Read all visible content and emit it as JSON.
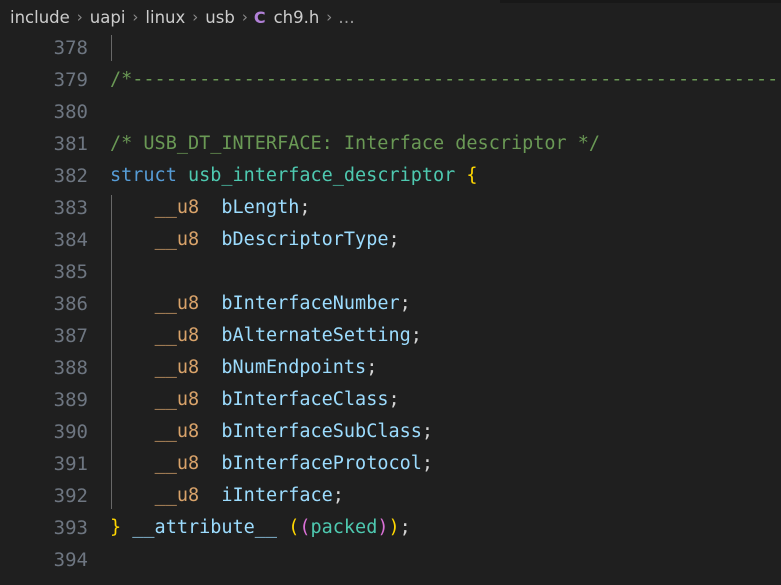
{
  "breadcrumb": {
    "separator": "›",
    "file_icon": "C",
    "items": [
      {
        "label": "include"
      },
      {
        "label": "uapi"
      },
      {
        "label": "linux"
      },
      {
        "label": "usb"
      },
      {
        "label": "ch9.h"
      }
    ],
    "overflow": "…"
  },
  "editor": {
    "language": "c",
    "theme": "dark-modern",
    "colors": {
      "background": "#1f1f1f",
      "line_number": "#6e7681",
      "comment": "#6a9955",
      "keyword": "#569cd6",
      "type": "#4ec9b0",
      "macro_type": "#d9a36a",
      "identifier": "#9cdcfe",
      "punctuation": "#d4d4d4",
      "bracket_level_1": "#ffd700",
      "bracket_level_2": "#da70d6",
      "indent_guide": "#686868"
    },
    "lines": [
      {
        "number": "378",
        "tokens": []
      },
      {
        "number": "379",
        "tokens": [
          {
            "t": "/*-------------------------------------------------------------------------",
            "c": "tok-comment"
          }
        ]
      },
      {
        "number": "380",
        "tokens": []
      },
      {
        "number": "381",
        "tokens": [
          {
            "t": "/* USB_DT_INTERFACE: Interface descriptor */",
            "c": "tok-comment"
          }
        ]
      },
      {
        "number": "382",
        "tokens": [
          {
            "t": "struct",
            "c": "tok-keyword"
          },
          {
            "t": " ",
            "c": "tok-punct"
          },
          {
            "t": "usb_interface_descriptor",
            "c": "tok-type"
          },
          {
            "t": " ",
            "c": "tok-punct"
          },
          {
            "t": "{",
            "c": "tok-br1"
          }
        ]
      },
      {
        "number": "383",
        "tokens": [
          {
            "t": "    ",
            "c": "tok-punct"
          },
          {
            "t": "__u8",
            "c": "tok-u8"
          },
          {
            "t": "  ",
            "c": "tok-punct"
          },
          {
            "t": "bLength",
            "c": "tok-ident"
          },
          {
            "t": ";",
            "c": "tok-punct"
          }
        ]
      },
      {
        "number": "384",
        "tokens": [
          {
            "t": "    ",
            "c": "tok-punct"
          },
          {
            "t": "__u8",
            "c": "tok-u8"
          },
          {
            "t": "  ",
            "c": "tok-punct"
          },
          {
            "t": "bDescriptorType",
            "c": "tok-ident"
          },
          {
            "t": ";",
            "c": "tok-punct"
          }
        ]
      },
      {
        "number": "385",
        "tokens": []
      },
      {
        "number": "386",
        "tokens": [
          {
            "t": "    ",
            "c": "tok-punct"
          },
          {
            "t": "__u8",
            "c": "tok-u8"
          },
          {
            "t": "  ",
            "c": "tok-punct"
          },
          {
            "t": "bInterfaceNumber",
            "c": "tok-ident"
          },
          {
            "t": ";",
            "c": "tok-punct"
          }
        ]
      },
      {
        "number": "387",
        "tokens": [
          {
            "t": "    ",
            "c": "tok-punct"
          },
          {
            "t": "__u8",
            "c": "tok-u8"
          },
          {
            "t": "  ",
            "c": "tok-punct"
          },
          {
            "t": "bAlternateSetting",
            "c": "tok-ident"
          },
          {
            "t": ";",
            "c": "tok-punct"
          }
        ]
      },
      {
        "number": "388",
        "tokens": [
          {
            "t": "    ",
            "c": "tok-punct"
          },
          {
            "t": "__u8",
            "c": "tok-u8"
          },
          {
            "t": "  ",
            "c": "tok-punct"
          },
          {
            "t": "bNumEndpoints",
            "c": "tok-ident"
          },
          {
            "t": ";",
            "c": "tok-punct"
          }
        ]
      },
      {
        "number": "389",
        "tokens": [
          {
            "t": "    ",
            "c": "tok-punct"
          },
          {
            "t": "__u8",
            "c": "tok-u8"
          },
          {
            "t": "  ",
            "c": "tok-punct"
          },
          {
            "t": "bInterfaceClass",
            "c": "tok-ident"
          },
          {
            "t": ";",
            "c": "tok-punct"
          }
        ]
      },
      {
        "number": "390",
        "tokens": [
          {
            "t": "    ",
            "c": "tok-punct"
          },
          {
            "t": "__u8",
            "c": "tok-u8"
          },
          {
            "t": "  ",
            "c": "tok-punct"
          },
          {
            "t": "bInterfaceSubClass",
            "c": "tok-ident"
          },
          {
            "t": ";",
            "c": "tok-punct"
          }
        ]
      },
      {
        "number": "391",
        "tokens": [
          {
            "t": "    ",
            "c": "tok-punct"
          },
          {
            "t": "__u8",
            "c": "tok-u8"
          },
          {
            "t": "  ",
            "c": "tok-punct"
          },
          {
            "t": "bInterfaceProtocol",
            "c": "tok-ident"
          },
          {
            "t": ";",
            "c": "tok-punct"
          }
        ]
      },
      {
        "number": "392",
        "tokens": [
          {
            "t": "    ",
            "c": "tok-punct"
          },
          {
            "t": "__u8",
            "c": "tok-u8"
          },
          {
            "t": "  ",
            "c": "tok-punct"
          },
          {
            "t": "iInterface",
            "c": "tok-ident"
          },
          {
            "t": ";",
            "c": "tok-punct"
          }
        ]
      },
      {
        "number": "393",
        "tokens": [
          {
            "t": "}",
            "c": "tok-br1"
          },
          {
            "t": " ",
            "c": "tok-punct"
          },
          {
            "t": "__attribute__",
            "c": "tok-ident"
          },
          {
            "t": " ",
            "c": "tok-punct"
          },
          {
            "t": "(",
            "c": "tok-br1"
          },
          {
            "t": "(",
            "c": "tok-br2"
          },
          {
            "t": "packed",
            "c": "tok-type"
          },
          {
            "t": ")",
            "c": "tok-br2"
          },
          {
            "t": ")",
            "c": "tok-br1"
          },
          {
            "t": ";",
            "c": "tok-punct"
          }
        ]
      },
      {
        "number": "394",
        "tokens": []
      }
    ],
    "indent_guides": [
      {
        "start_line_index": 0,
        "span_lines": 1
      },
      {
        "start_line_index": 5,
        "span_lines": 10
      }
    ]
  }
}
